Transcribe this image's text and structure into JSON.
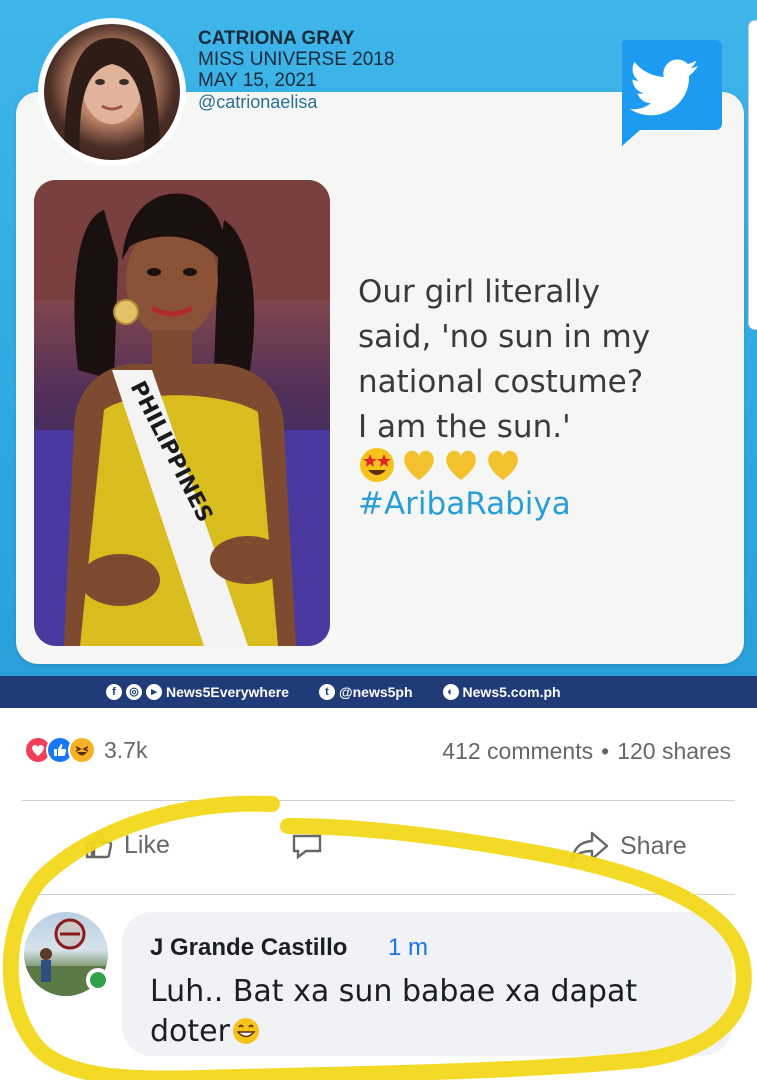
{
  "tweet": {
    "author": "CATRIONA GRAY",
    "title": "MISS UNIVERSE 2018",
    "date": "MAY 15, 2021",
    "handle": "@catrionaelisa",
    "text_lines": [
      "Our girl literally",
      "said, 'no sun in my",
      "national costume?",
      "I am the sun.'"
    ],
    "emojis": [
      "star-struck-emoji",
      "yellow-heart-emoji",
      "yellow-heart-emoji",
      "yellow-heart-emoji"
    ],
    "hashtag": "#AribaRabiya",
    "photo_sash": "PHILIPPINES"
  },
  "footer": {
    "facebook": "News5Everywhere",
    "twitter": "@news5ph",
    "website": "News5.com.ph"
  },
  "post": {
    "reaction_count": "3.7k",
    "comments": "412 comments",
    "separator": "•",
    "shares": "120 shares",
    "like_label": "Like",
    "share_label": "Share"
  },
  "comment": {
    "name": "J Grande Castillo",
    "time": "1 m",
    "text": "Luh.. Bat xa sun babae xa dapat doter"
  },
  "colors": {
    "brand_blue": "#2ea8e0",
    "footer_navy": "#1f3c78",
    "highlight": "#f2d81b",
    "fb_link": "#1b74e4"
  }
}
